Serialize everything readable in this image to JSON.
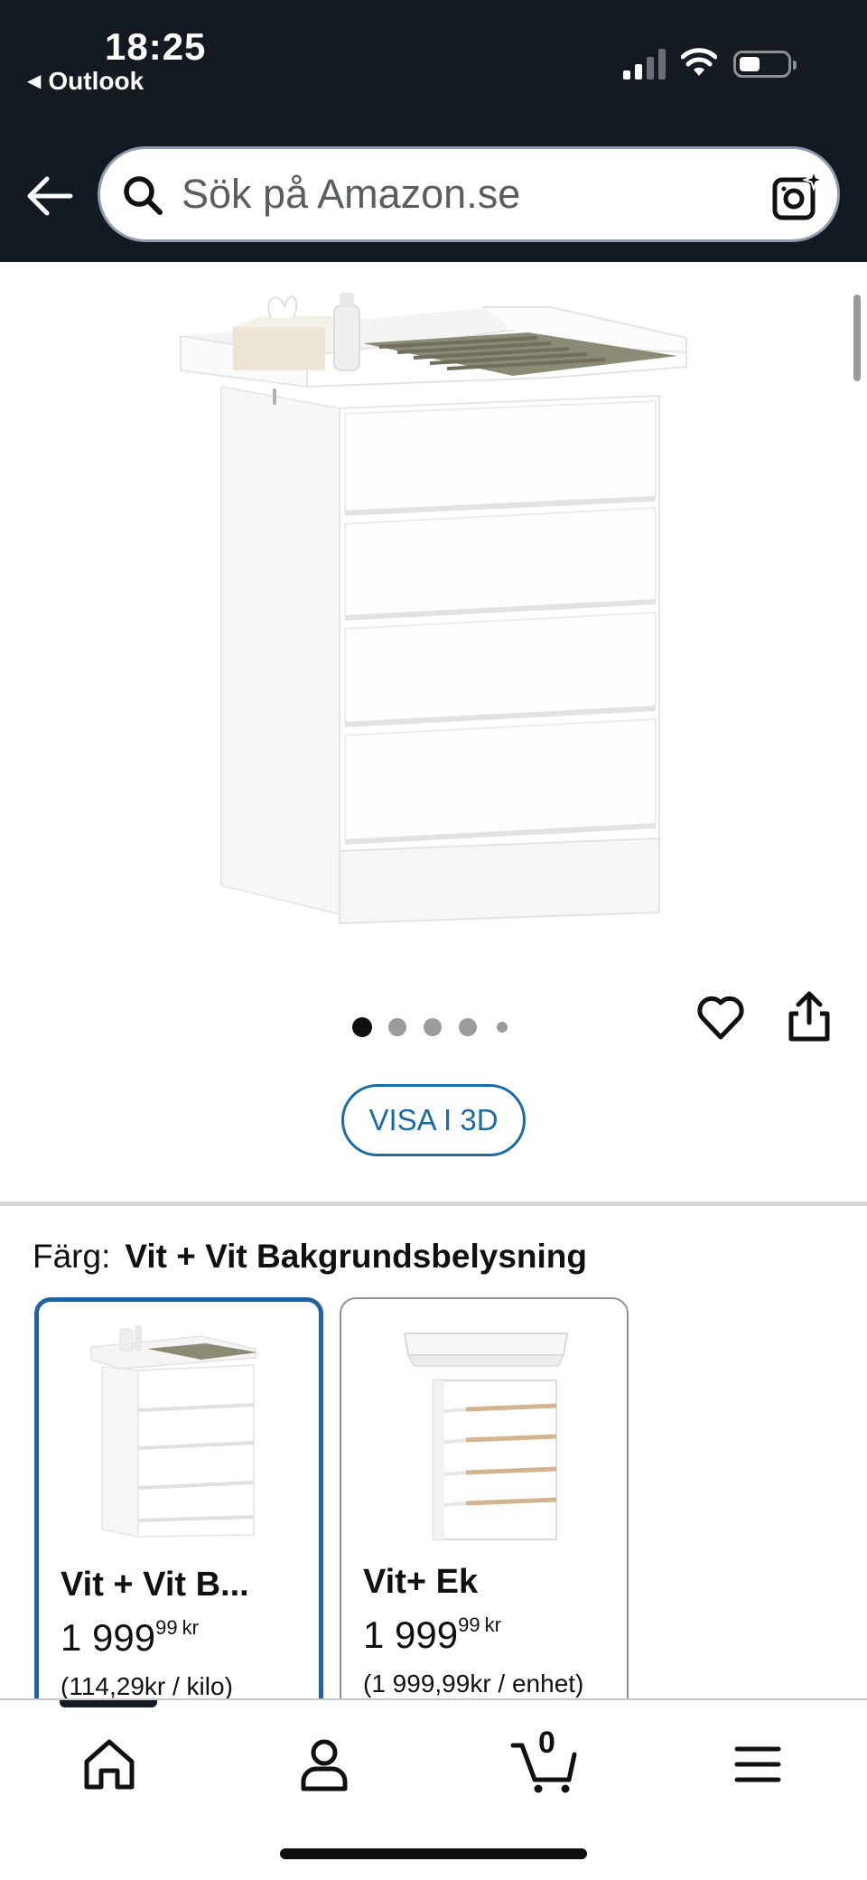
{
  "status_bar": {
    "time": "18:25",
    "back_app": "Outlook",
    "icons": [
      "cellular-signal-icon",
      "wifi-icon",
      "battery-icon"
    ]
  },
  "search": {
    "placeholder": "Sök på Amazon.se",
    "icons": [
      "back-arrow-icon",
      "search-icon",
      "camera-icon"
    ]
  },
  "gallery": {
    "image_count": 5,
    "active_index": 0,
    "view_3d_label": "VISA I 3D",
    "icons": [
      "heart-icon",
      "share-icon"
    ]
  },
  "color_selector": {
    "label": "Färg:",
    "selected_value": "Vit + Vit Bakgrundsbelysning",
    "variants": [
      {
        "name": "Vit + Vit B...",
        "price_whole": "1 999",
        "price_fraction": "99",
        "currency": "kr",
        "unit_price": "(114,29kr / kilo)",
        "selected": true
      },
      {
        "name": "Vit+ Ek",
        "price_whole": "1 999",
        "price_fraction": "99",
        "currency": "kr",
        "unit_price": "(1 999,99kr / enhet)",
        "selected": false
      }
    ]
  },
  "bottom_nav": {
    "items": [
      "home-icon",
      "account-icon",
      "cart-icon",
      "menu-icon"
    ],
    "cart_count": "0"
  },
  "colors": {
    "header_bg": "#131a22",
    "link_blue": "#1b6aa8",
    "selected_border": "#2162a1"
  }
}
